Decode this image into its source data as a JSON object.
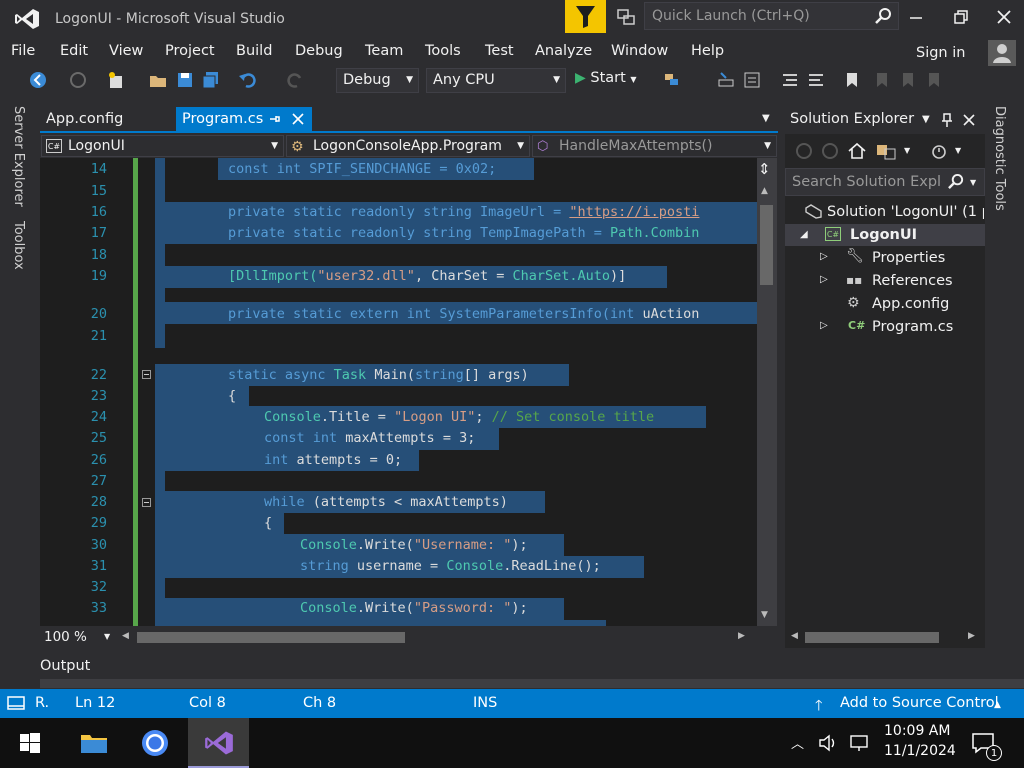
{
  "window": {
    "title": "LogonUI - Microsoft Visual Studio"
  },
  "quick_launch": {
    "placeholder": "Quick Launch (Ctrl+Q)"
  },
  "menu": [
    "File",
    "Edit",
    "View",
    "Project",
    "Build",
    "Debug",
    "Team",
    "Tools",
    "Test",
    "Analyze",
    "Window",
    "Help"
  ],
  "account": {
    "signin_label": "Sign in"
  },
  "toolbar": {
    "config": "Debug",
    "platform": "Any CPU",
    "start_label": "Start"
  },
  "left_rail": {
    "server_explorer": "Server Explorer",
    "toolbox": "Toolbox"
  },
  "tabs": [
    {
      "label": "App.config"
    },
    {
      "label": "Program.cs"
    }
  ],
  "nav": {
    "project": "LogonUI",
    "class": "LogonConsoleApp.Program",
    "member": "HandleMaxAttempts()"
  },
  "editor": {
    "line_numbers": [
      "14",
      "15",
      "16",
      "17",
      "18",
      "19",
      "20",
      "21",
      "22",
      "23",
      "24",
      "25",
      "26",
      "27",
      "28",
      "29",
      "30",
      "31",
      "32",
      "33"
    ],
    "zoom": "100 %"
  },
  "code": {
    "l14": "const int SPIF_SENDCHANGE = 0x02;",
    "l16a": "private static readonly string ImageUrl = ",
    "l16b": "\"https://i.posti",
    "l17a": "private static readonly string TempImagePath = ",
    "l17b": "Path.Combin",
    "l19a": "[DllImport(",
    "l19b": "\"user32.dll\"",
    "l19c": ", CharSet = ",
    "l19d": "CharSet.Auto",
    "l19e": ")]",
    "l20a": "private static extern int SystemParametersInfo(",
    "l20b": "int",
    "l20c": " uAction",
    "l22a": "static async ",
    "l22b": "Task",
    "l22c": " Main(",
    "l22d": "string",
    "l22e": "[] args)",
    "l23": "{",
    "l24a": "Console",
    "l24b": ".Title = ",
    "l24c": "\"Logon UI\"",
    "l24d": "; ",
    "l24e": "// Set console title",
    "l25a": "const int",
    "l25b": " maxAttempts = 3;",
    "l26a": "int",
    "l26b": " attempts = 0;",
    "l28a": "while",
    "l28b": " (attempts < maxAttempts)",
    "l29": "{",
    "l30a": "Console",
    "l30b": ".Write(",
    "l30c": "\"Username: \"",
    "l30d": ");",
    "l31a": "string",
    "l31b": " username = ",
    "l31c": "Console",
    "l31d": ".ReadLine();",
    "l33a": "Console",
    "l33b": ".Write(",
    "l33c": "\"Password: \"",
    "l33d": ");"
  },
  "solution_explorer": {
    "title": "Solution Explorer",
    "search_placeholder": "Search Solution Explor",
    "solution": "Solution 'LogonUI' (1 pr",
    "project": "LogonUI",
    "items": [
      "Properties",
      "References",
      "App.config",
      "Program.cs"
    ]
  },
  "right_rail": {
    "diagnostic_tools": "Diagnostic Tools"
  },
  "output": {
    "label": "Output"
  },
  "status": {
    "ready": "R.",
    "ln": "Ln 12",
    "col": "Col 8",
    "ch": "Ch 8",
    "mode": "INS",
    "source_control": "Add to Source Control"
  },
  "taskbar": {
    "time": "10:09 AM",
    "date": "11/1/2024",
    "notifications": "1"
  },
  "colors": {
    "accent": "#007acc",
    "selection": "#264f78",
    "keyword": "#569cd6",
    "type": "#4ec9b0",
    "string": "#d69d85",
    "comment": "#57a64a"
  }
}
